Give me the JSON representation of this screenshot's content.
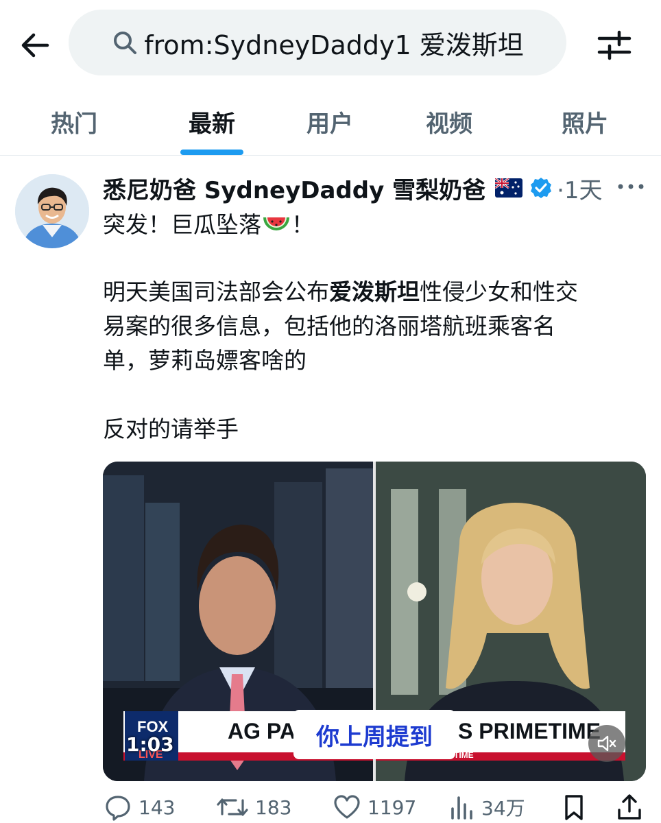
{
  "search": {
    "query": "from:SydneyDaddy1 爱泼斯坦"
  },
  "tabs": [
    {
      "label": "热门"
    },
    {
      "label": "最新"
    },
    {
      "label": "用户"
    },
    {
      "label": "视频"
    },
    {
      "label": "照片"
    }
  ],
  "active_tab": "最新",
  "tweet": {
    "display_name": "悉尼奶爸 SydneyDaddy 雪梨奶爸",
    "time": "·1天",
    "line1": "突发！巨瓜坠落",
    "line1_end": "！",
    "para_pre": "明天美国司法部会公布",
    "para_keyword": "爱泼斯坦",
    "para_post_1": "性侵少女和性交",
    "para_line2": "易案的很多信息，包括他的洛丽塔航班乘客名",
    "para_line3": "单，萝莉岛嫖客啥的",
    "closing": "反对的请举手",
    "video": {
      "duration": "1:03",
      "caption": "你上周提到",
      "banner_left": "AG PA",
      "banner_right": "S PRIMETIME",
      "banner_sub": "TIME",
      "network": "FOX",
      "network_sub": "LIVE"
    },
    "actions": {
      "replies": "143",
      "retweets": "183",
      "likes": "1197",
      "views": "34万"
    }
  },
  "colors": {
    "accent": "#1d9bf0",
    "text_primary": "#0f1419",
    "text_secondary": "#536471",
    "search_bg": "#eff3f4"
  },
  "icons": [
    "back-arrow-icon",
    "search-icon",
    "filter-sliders-icon",
    "verified-badge-icon",
    "australia-flag-icon",
    "more-icon",
    "watermelon-emoji-icon",
    "mute-icon",
    "reply-icon",
    "retweet-icon",
    "like-icon",
    "views-icon",
    "bookmark-icon",
    "share-icon"
  ]
}
